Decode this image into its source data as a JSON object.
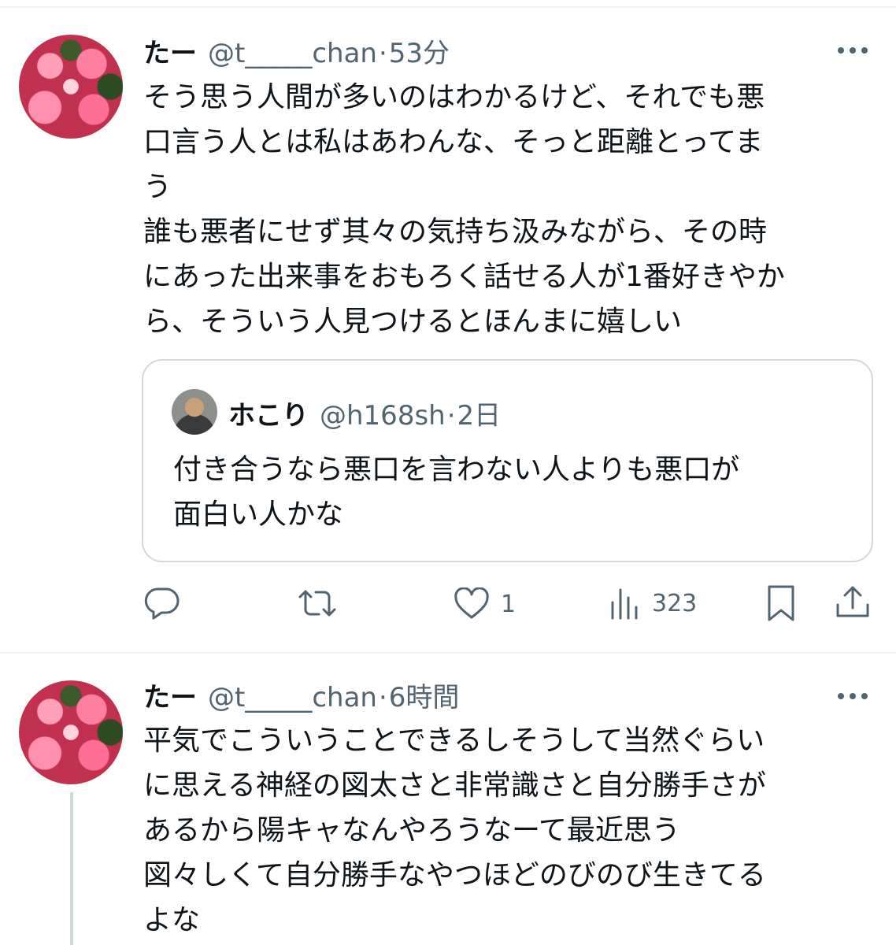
{
  "tweets": [
    {
      "name": "たー",
      "handle": "@t_____chan",
      "time": "53分",
      "text": "そう思う人間が多いのはわかるけど、それでも悪\n口言う人とは私はあわんな、そっと距離とってま\nう\n誰も悪者にせず其々の気持ち汲みながら、その時\nにあった出来事をおもろく話せる人が1番好きやか\nら、そういう人見つけるとほんまに嬉しい",
      "quote": {
        "name": "ホこり",
        "handle": "@h168sh",
        "time": "2日",
        "text": "付き合うなら悪口を言わない人よりも悪口が\n面白い人かな"
      },
      "actions": {
        "reply_count": "",
        "retweet_count": "",
        "like_count": "1",
        "view_count": "323"
      }
    },
    {
      "name": "たー",
      "handle": "@t_____chan",
      "time": "6時間",
      "text": "平気でこういうことできるしそうして当然ぐらい\nに思える神経の図太さと非常識さと自分勝手さが\nあるから陽キャなんやろうなーて最近思う\n図々しくて自分勝手なやつほどのびのび生きてる\nよな"
    }
  ],
  "separator": "·"
}
